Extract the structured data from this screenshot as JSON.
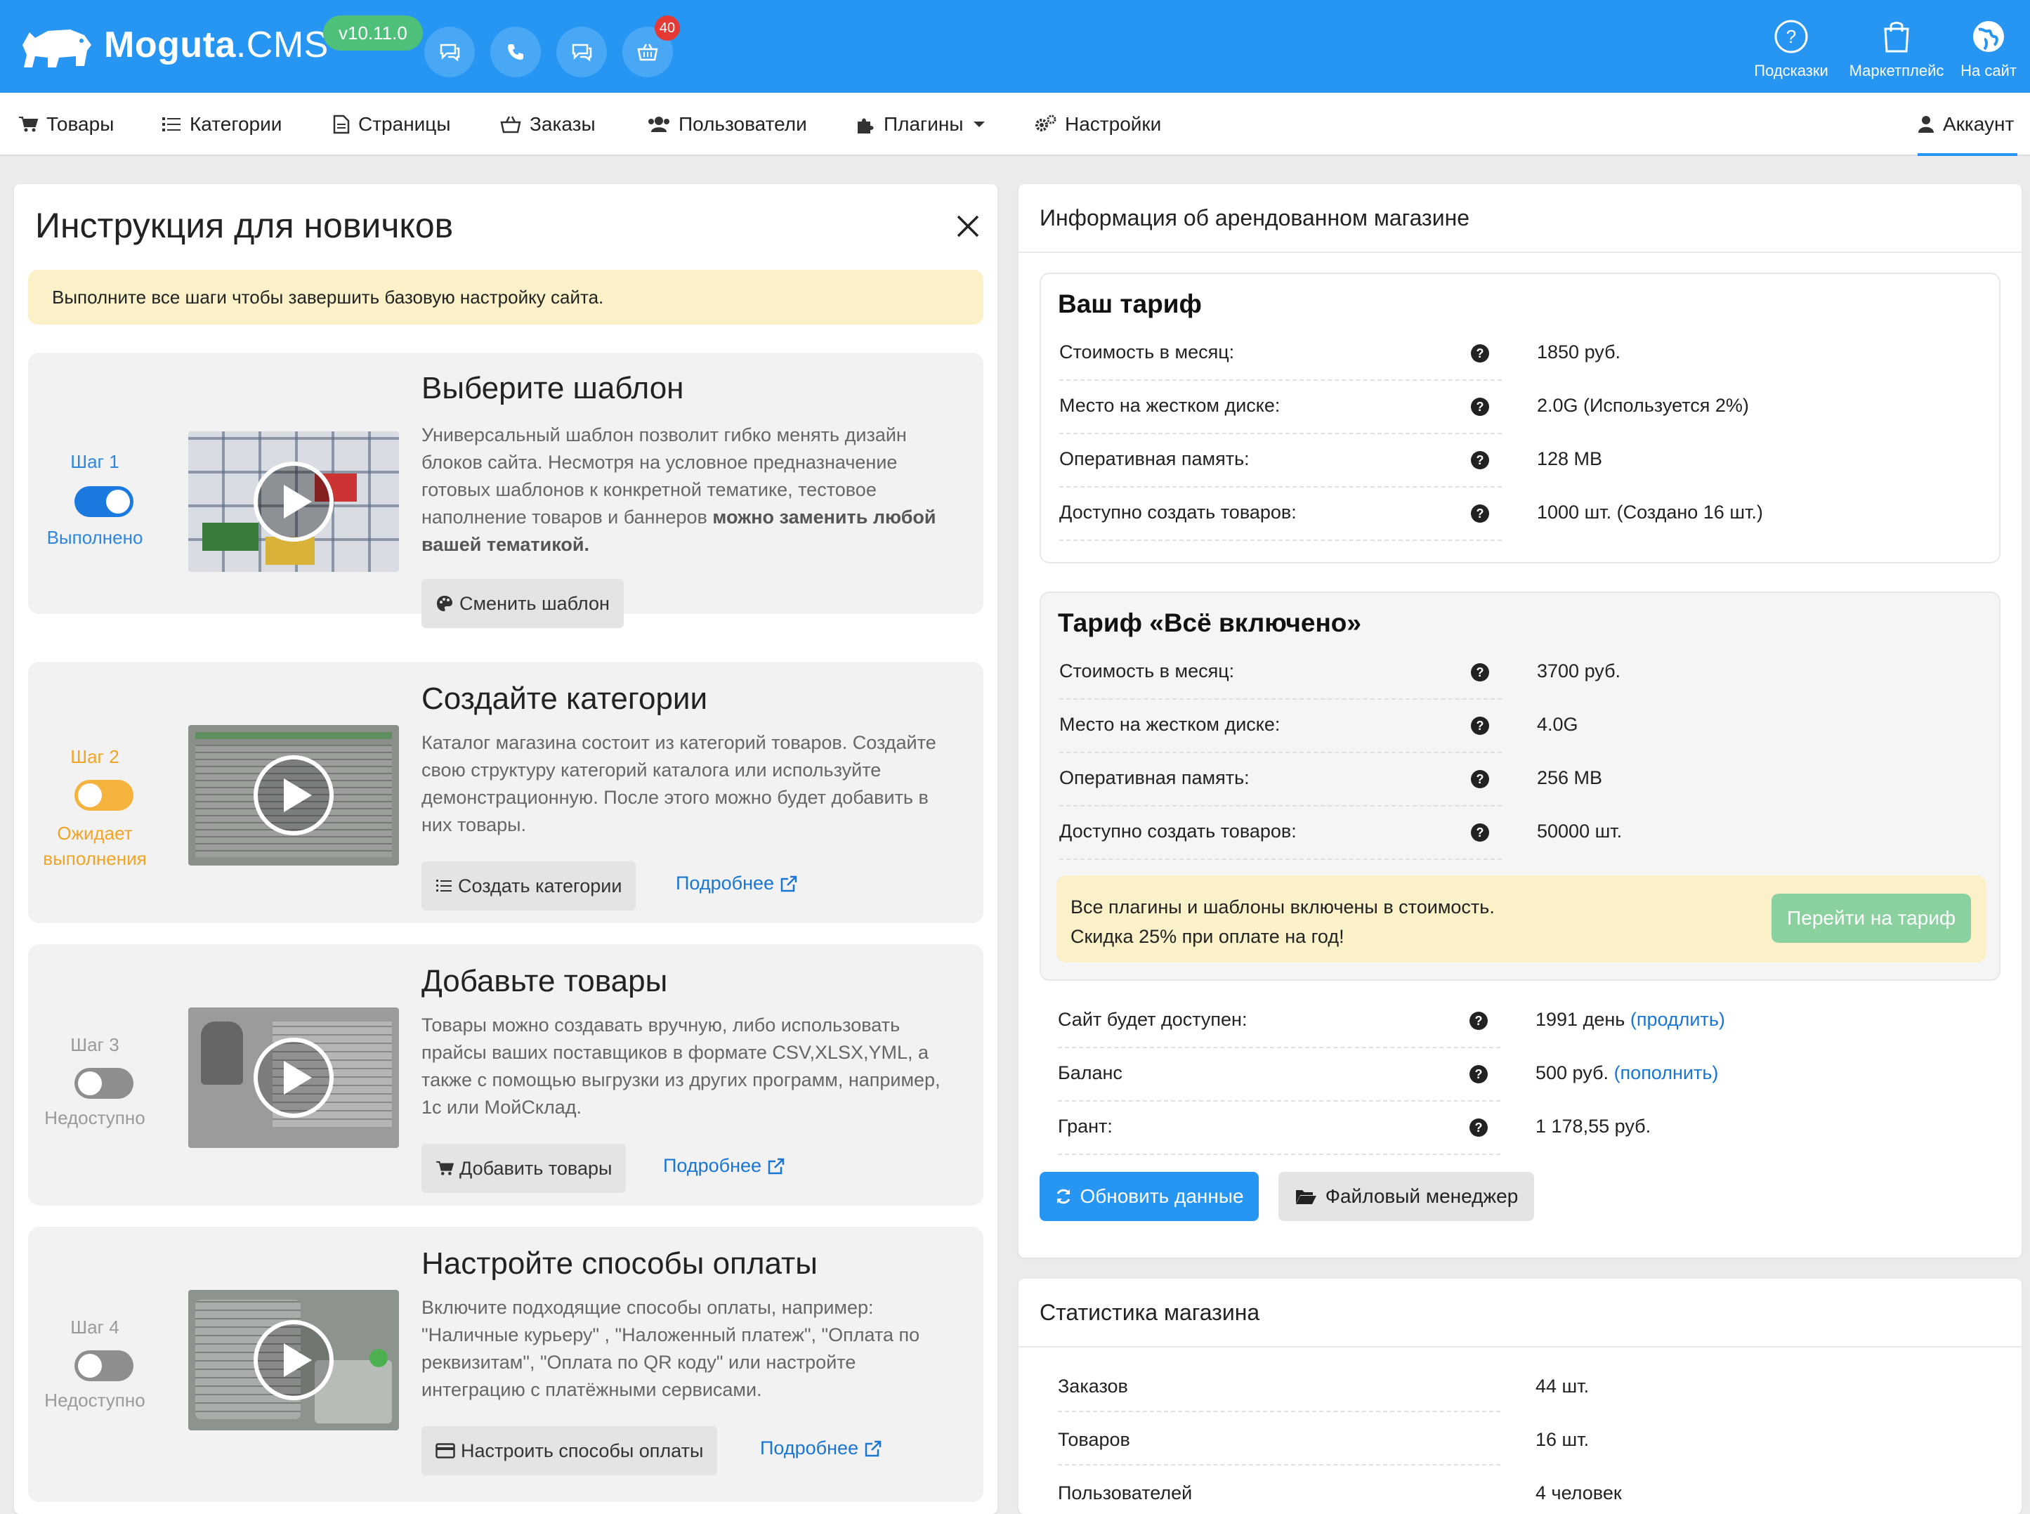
{
  "header": {
    "brand_main": "Moguta",
    "brand_suffix": ".CMS",
    "version": "v10.11.0",
    "cart_badge": "40",
    "right_links": [
      {
        "label": "Подсказки",
        "icon": "question-circle-icon"
      },
      {
        "label": "Маркетплейс",
        "icon": "shopping-bag-icon"
      },
      {
        "label": "На сайт",
        "icon": "globe-icon"
      }
    ],
    "brand_color": "#2696f2"
  },
  "nav": {
    "items": [
      {
        "label": "Товары",
        "icon": "cart-icon"
      },
      {
        "label": "Категории",
        "icon": "list-icon"
      },
      {
        "label": "Страницы",
        "icon": "file-icon"
      },
      {
        "label": "Заказы",
        "icon": "basket-icon"
      },
      {
        "label": "Пользователи",
        "icon": "users-icon"
      },
      {
        "label": "Плагины",
        "icon": "puzzle-icon"
      },
      {
        "label": "Настройки",
        "icon": "gears-icon"
      }
    ],
    "account": "Аккаунт"
  },
  "guide": {
    "title": "Инструкция для новичков",
    "alert": "Выполните все шаги чтобы завершить базовую настройку сайта.",
    "steps": [
      {
        "label": "Шаг 1",
        "status": "Выполнено",
        "state": "done",
        "title": "Выберите шаблон",
        "desc_plain": "Универсальный шаблон позволит гибко менять дизайн блоков сайта. Несмотря на условное предназначение готовых шаблонов к конкретной тематике, тестовое наполнение товаров и баннеров ",
        "desc_bold": "можно заменить любой вашей тематикой.",
        "button": "Сменить шаблон",
        "more": ""
      },
      {
        "label": "Шаг 2",
        "status": "Ожидает выполнения",
        "state": "pending",
        "title": "Создайте категории",
        "desc_plain": "Каталог магазина состоит из категорий товаров. Создайте свою структуру категорий каталога или используйте демонстрационную. После этого можно будет добавить в них товары.",
        "desc_bold": "",
        "button": "Создать категории",
        "more": "Подробнее"
      },
      {
        "label": "Шаг 3",
        "status": "Недоступно",
        "state": "disabled",
        "title": "Добавьте товары",
        "desc_plain": "Товары можно создавать вручную, либо использовать прайсы ваших поставщиков в формате CSV,XLSX,YML, а также с помощью выгрузки из других программ, например, 1с или МойСклад.",
        "desc_bold": "",
        "button": "Добавить товары",
        "more": "Подробнее"
      },
      {
        "label": "Шаг 4",
        "status": "Недоступно",
        "state": "disabled",
        "title": "Настройте способы оплаты",
        "desc_plain": "Включите подходящие способы оплаты, например: \"Наличные курьеру\" , \"Наложенный платеж\", \"Оплата по реквизитам\", \"Оплата по QR коду\" или настройте интеграцию с платёжными сервисами.",
        "desc_bold": "",
        "button": "Настроить способы оплаты",
        "more": "Подробнее"
      }
    ]
  },
  "store_info": {
    "title": "Информация об арендованном магазине",
    "current_plan": {
      "title": "Ваш тариф",
      "rows": [
        {
          "key": "Стоимость в месяц:",
          "value": "1850 руб."
        },
        {
          "key": "Место на жестком диске:",
          "value": "2.0G (Используется 2%)"
        },
        {
          "key": "Оперативная память:",
          "value": "128 MB"
        },
        {
          "key": "Доступно создать товаров:",
          "value": "1000 шт. (Создано 16 шт.)"
        }
      ]
    },
    "all_inclusive_plan": {
      "title": "Тариф «Всё включено»",
      "rows": [
        {
          "key": "Стоимость в месяц:",
          "value": "3700 руб."
        },
        {
          "key": "Место на жестком диске:",
          "value": "4.0G"
        },
        {
          "key": "Оперативная память:",
          "value": "256 MB"
        },
        {
          "key": "Доступно создать товаров:",
          "value": "50000 шт."
        }
      ],
      "promo_line1": "Все плагины и шаблоны включены в стоимость.",
      "promo_line2": "Скидка 25% при оплате на год!",
      "promo_button": "Перейти на тариф"
    },
    "account_rows": [
      {
        "key": "Сайт будет доступен:",
        "value": "1991 день",
        "link": "(продлить)"
      },
      {
        "key": "Баланс",
        "value": "500 руб.",
        "link": "(пополнить)"
      },
      {
        "key": "Грант:",
        "value": "1 178,55 руб.",
        "link": ""
      }
    ],
    "refresh_button": "Обновить данные",
    "files_button": "Файловый менеджер"
  },
  "stats": {
    "title": "Статистика магазина",
    "rows": [
      {
        "key": "Заказов",
        "value": "44 шт."
      },
      {
        "key": "Товаров",
        "value": "16 шт."
      },
      {
        "key": "Пользователей",
        "value": "4 человек"
      }
    ]
  }
}
